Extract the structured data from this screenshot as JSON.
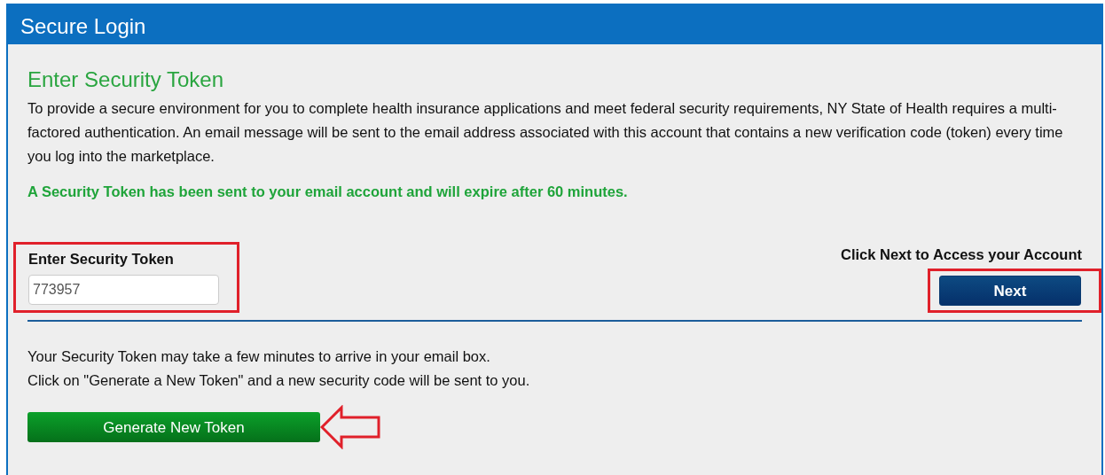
{
  "window": {
    "title": "Secure Login"
  },
  "heading": "Enter Security Token",
  "intro": "To provide a secure environment for you to complete health insurance applications and meet federal security requirements, NY State of Health requires a multi-factored authentication. An email message will be sent to the email address associated with this account that contains a new verification code (token) every time you log into the marketplace.",
  "notice": "A Security Token has been sent to your email account and will expire after 60 minutes.",
  "token_field": {
    "label": "Enter Security Token",
    "value": "773957"
  },
  "next": {
    "hint": "Click Next to Access your Account",
    "button": "Next"
  },
  "help_lines": [
    "Your Security Token may take a few minutes to arrive in your email box.",
    "Click on \"Generate a New Token\" and a new security code will be sent to you."
  ],
  "generate_button": "Generate New Token"
}
